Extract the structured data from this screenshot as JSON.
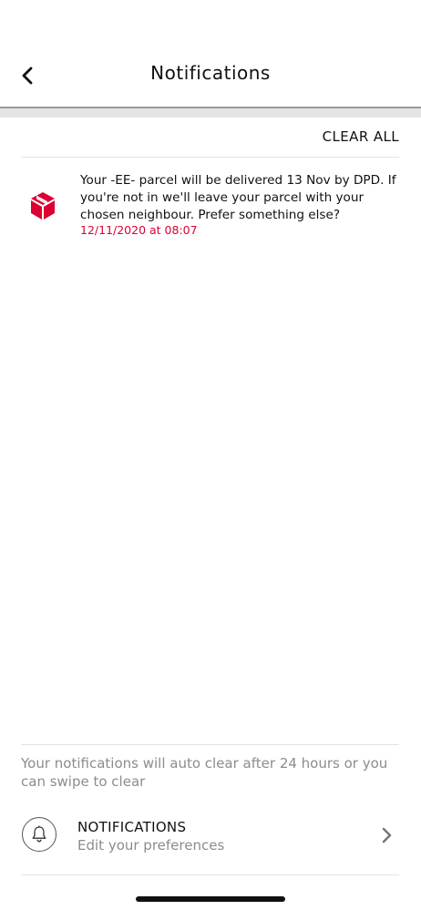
{
  "header": {
    "title": "Notifications",
    "back_icon": "chevron-left-icon"
  },
  "actions": {
    "clear_all": "CLEAR ALL"
  },
  "notifications": [
    {
      "icon": "dpd-parcel-icon",
      "message": "Your -EE- parcel will be delivered 13 Nov by DPD. If you're not in we'll leave your parcel with your chosen neighbour. Prefer something else?",
      "timestamp": "12/11/2020 at 08:07"
    }
  ],
  "footer": {
    "note": "Your notifications will auto clear after 24 hours or you can swipe to clear",
    "preferences": {
      "icon": "bell-icon",
      "title": "NOTIFICATIONS",
      "subtitle": "Edit your preferences",
      "chevron": "chevron-right-icon"
    }
  },
  "colors": {
    "brand_red": "#dc0032",
    "muted_text": "#8c8c8c"
  }
}
